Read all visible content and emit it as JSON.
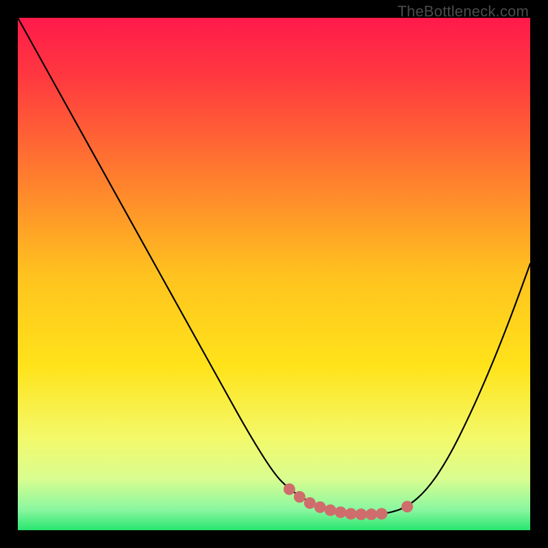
{
  "watermark": "TheBottleneck.com",
  "colors": {
    "frame": "#000000",
    "curve_stroke": "#000000",
    "marker_fill": "#cf6d6d",
    "marker_stroke": "#b85a5a",
    "gradient_stops": [
      {
        "offset": 0.0,
        "color": "#ff1a4b"
      },
      {
        "offset": 0.12,
        "color": "#ff3a3f"
      },
      {
        "offset": 0.3,
        "color": "#ff7a2f"
      },
      {
        "offset": 0.5,
        "color": "#ffc21f"
      },
      {
        "offset": 0.68,
        "color": "#ffe31a"
      },
      {
        "offset": 0.82,
        "color": "#f3f96a"
      },
      {
        "offset": 0.9,
        "color": "#d9fd90"
      },
      {
        "offset": 0.96,
        "color": "#8af7a0"
      },
      {
        "offset": 1.0,
        "color": "#28e66f"
      }
    ]
  },
  "chart_data": {
    "type": "line",
    "title": "",
    "xlabel": "",
    "ylabel": "",
    "xlim": [
      0,
      100
    ],
    "ylim": [
      0,
      100
    ],
    "series": [
      {
        "name": "bottleneck-curve",
        "x": [
          0,
          5,
          10,
          15,
          20,
          25,
          30,
          35,
          40,
          45,
          50,
          53,
          56,
          59,
          62,
          65,
          68,
          72,
          76,
          80,
          84,
          88,
          92,
          96,
          100
        ],
        "y": [
          100,
          91,
          82,
          73,
          64,
          55,
          46,
          37,
          28,
          19,
          11,
          8,
          6,
          4.5,
          3.6,
          3.2,
          3.1,
          3.2,
          4.5,
          8,
          14,
          22,
          31,
          41,
          52
        ]
      }
    ],
    "markers": [
      {
        "x": 53,
        "y": 8.0
      },
      {
        "x": 55,
        "y": 6.5
      },
      {
        "x": 57,
        "y": 5.3
      },
      {
        "x": 59,
        "y": 4.5
      },
      {
        "x": 61,
        "y": 3.9
      },
      {
        "x": 63,
        "y": 3.5
      },
      {
        "x": 65,
        "y": 3.2
      },
      {
        "x": 67,
        "y": 3.1
      },
      {
        "x": 69,
        "y": 3.1
      },
      {
        "x": 71,
        "y": 3.2
      },
      {
        "x": 76,
        "y": 4.6
      }
    ]
  }
}
